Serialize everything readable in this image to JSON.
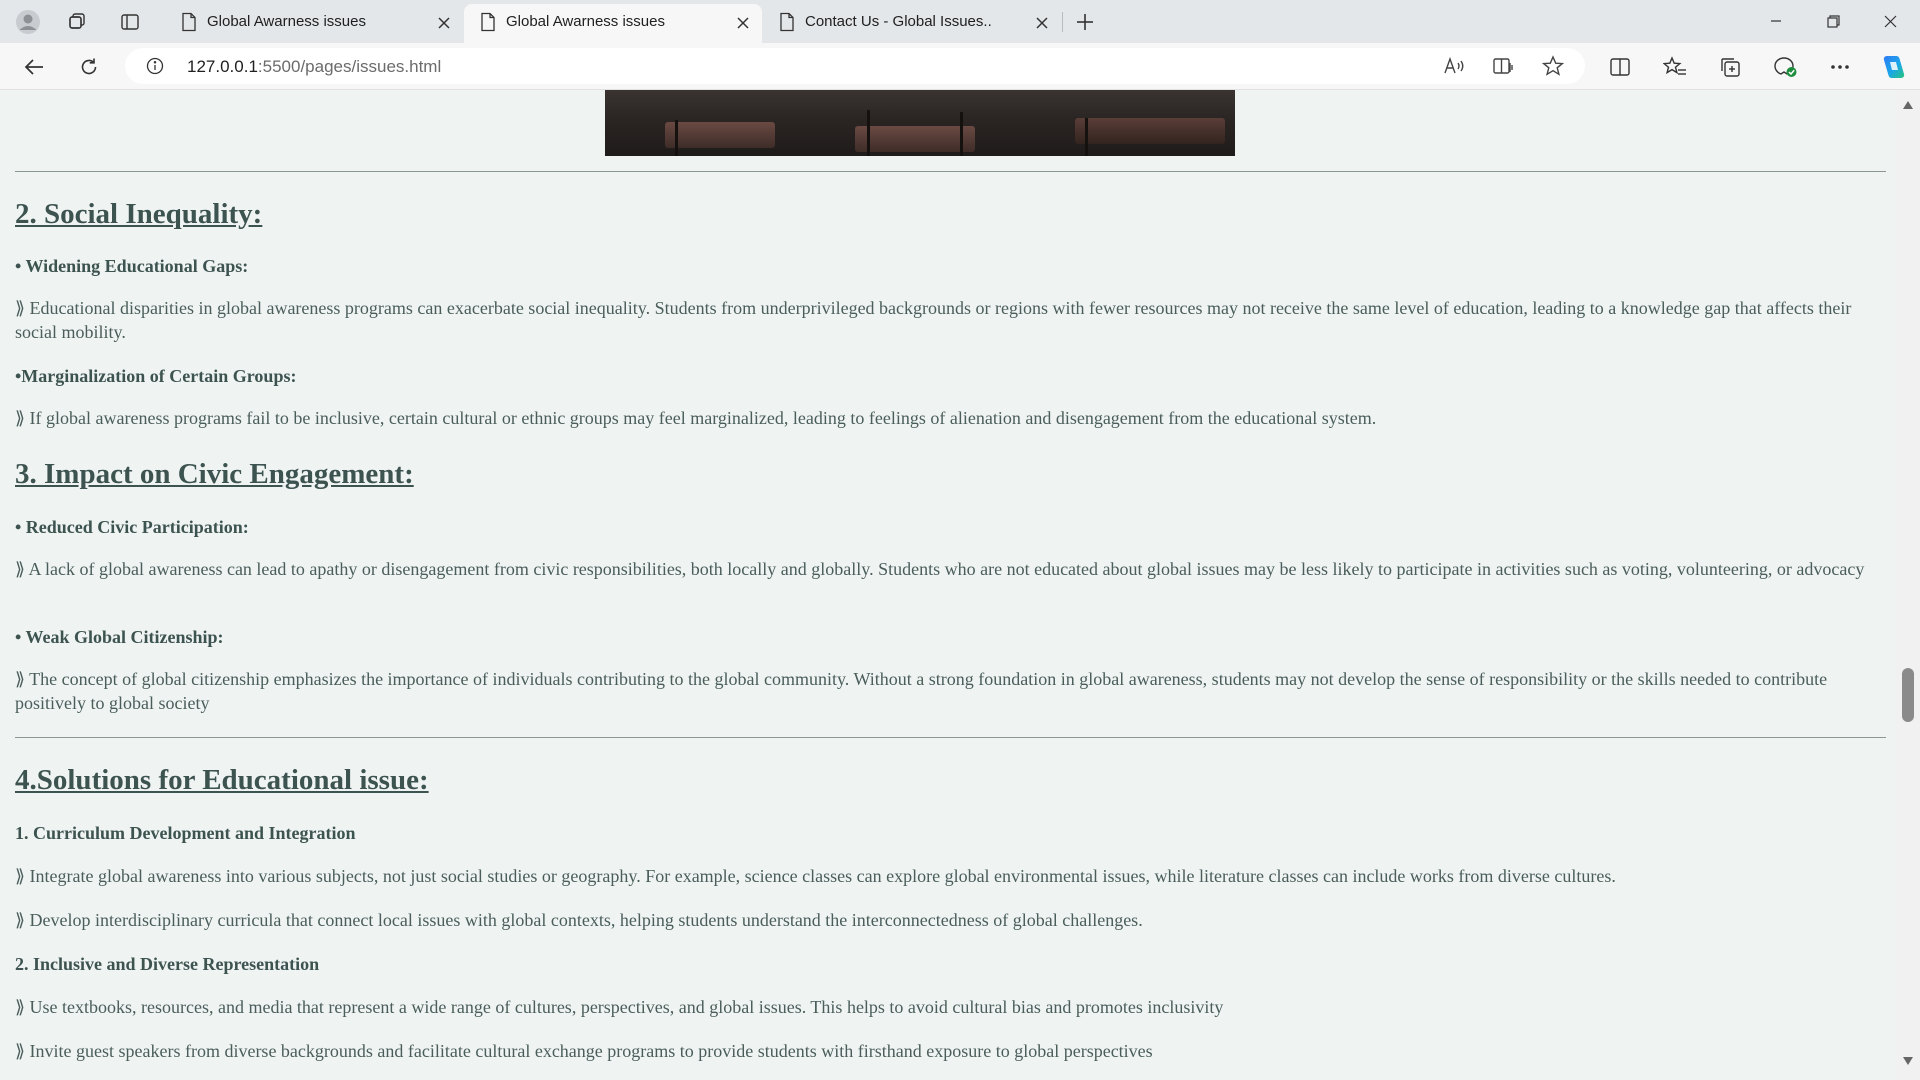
{
  "browser": {
    "tabs": [
      {
        "title": "Global Awarness issues",
        "active": false
      },
      {
        "title": "Global Awarness issues",
        "active": true
      },
      {
        "title": "Contact Us - Global Issues..",
        "active": false
      }
    ],
    "url_host": "127.0.0.1",
    "url_rest": ":5500/pages/issues.html"
  },
  "content": {
    "section2": {
      "heading": "2. Social Inequality:",
      "items": [
        {
          "title": "• Widening Educational Gaps:",
          "text": "⟫ Educational disparities in global awareness programs can exacerbate social inequality. Students from underprivileged backgrounds or regions with fewer resources may not receive the same level of education, leading to a knowledge gap that affects their social mobility."
        },
        {
          "title": "•Marginalization of Certain Groups:",
          "text": "⟫ If global awareness programs fail to be inclusive, certain cultural or ethnic groups may feel marginalized, leading to feelings of alienation and disengagement from the educational system."
        }
      ]
    },
    "section3": {
      "heading": "3. Impact on Civic Engagement:",
      "items": [
        {
          "title": "• Reduced Civic Participation:",
          "text": "⟫ A lack of global awareness can lead to apathy or disengagement from civic responsibilities, both locally and globally. Students who are not educated about global issues may be less likely to participate in activities such as voting, volunteering, or advocacy"
        },
        {
          "title": "• Weak Global Citizenship:",
          "text": "⟫ The concept of global citizenship emphasizes the importance of individuals contributing to the global community. Without a strong foundation in global awareness, students may not develop the sense of responsibility or the skills needed to contribute positively to global society"
        }
      ]
    },
    "section4": {
      "heading": "4.Solutions for Educational issue:",
      "items": [
        {
          "title": "1. Curriculum Development and Integration",
          "texts": [
            "⟫ Integrate global awareness into various subjects, not just social studies or geography. For example, science classes can explore global environmental issues, while literature classes can include works from diverse cultures.",
            "⟫ Develop interdisciplinary curricula that connect local issues with global contexts, helping students understand the interconnectedness of global challenges."
          ]
        },
        {
          "title": "2. Inclusive and Diverse Representation",
          "texts": [
            "⟫ Use textbooks, resources, and media that represent a wide range of cultures, perspectives, and global issues. This helps to avoid cultural bias and promotes inclusivity",
            "⟫ Invite guest speakers from diverse backgrounds and facilitate cultural exchange programs to provide students with firsthand exposure to global perspectives"
          ]
        }
      ]
    }
  },
  "icons": {
    "profile": "profile-icon",
    "workspaces": "workspaces-icon",
    "tab_actions": "tab-actions-icon",
    "back": "back-arrow-icon",
    "refresh": "refresh-icon",
    "info": "site-info-icon",
    "read_aloud": "read-aloud-icon",
    "immersive": "immersive-reader-icon",
    "favorite": "favorite-star-icon",
    "split": "split-screen-icon",
    "favorites": "favorites-icon",
    "collections": "collections-icon",
    "browser_essentials": "browser-essentials-icon",
    "more": "more-dots-icon",
    "copilot": "copilot-icon"
  },
  "colors": {
    "page_bg": "#eff4f3",
    "text": "#3d5350",
    "tab_bar": "#e4e7ea",
    "active_tab": "#f7f7f7"
  }
}
